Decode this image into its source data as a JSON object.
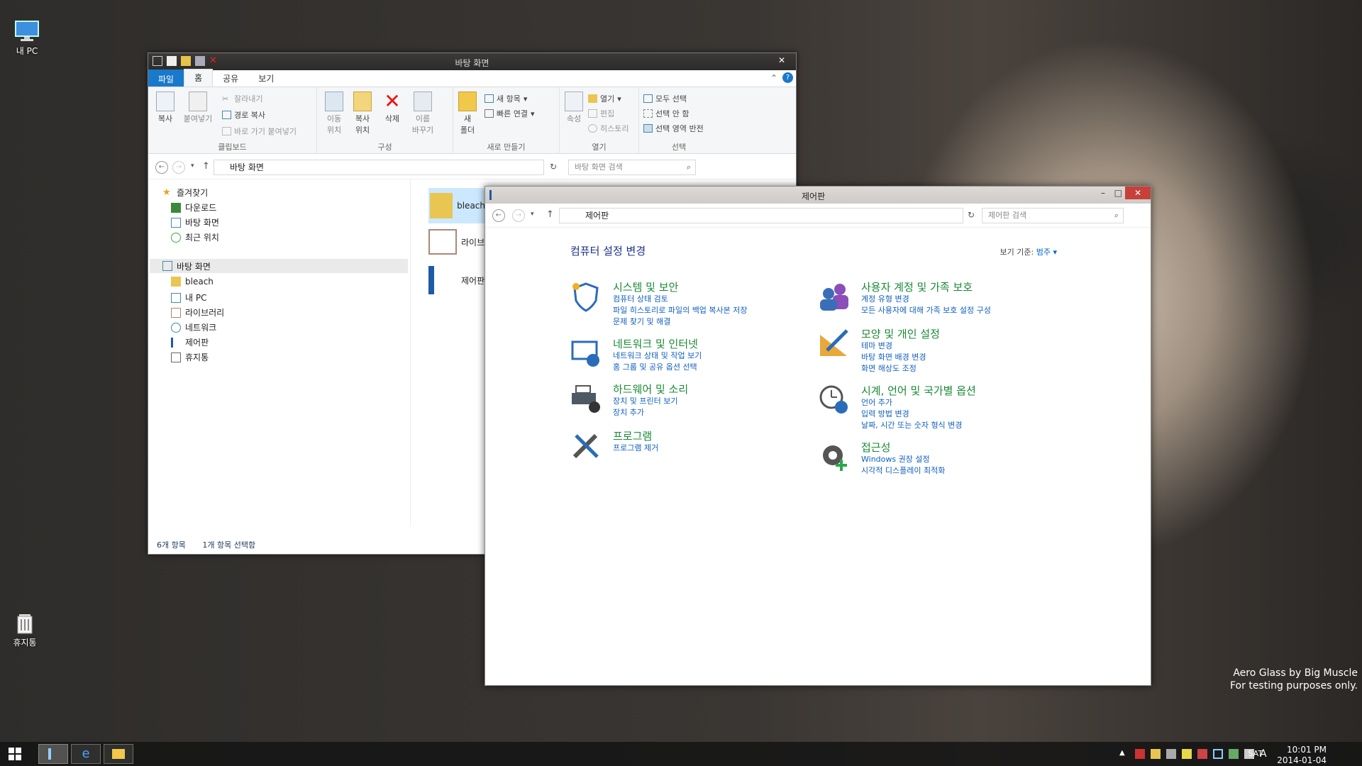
{
  "desktop": {
    "icons": [
      {
        "label": "내 PC",
        "icon": "monitor-icon"
      },
      {
        "label": "휴지통",
        "icon": "recycle-bin-icon"
      }
    ],
    "watermark": [
      "Aero Glass by Big Muscle",
      "For testing purposes only."
    ]
  },
  "explorer": {
    "title": "바탕 화면",
    "close": "✕",
    "tabs": [
      "파일",
      "홈",
      "공유",
      "보기"
    ],
    "ribbon": {
      "clipboard": {
        "copy": "복사",
        "paste": "붙여넣기",
        "cut": "잘라내기",
        "copy_path": "경로 복사",
        "paste_shortcut": "바로 가기 붙여넣기",
        "label": "클립보드"
      },
      "organize": {
        "move_to": "이동\n위치",
        "copy_to": "복사\n위치",
        "delete": "삭제",
        "rename": "이름\n바꾸기",
        "label": "구성"
      },
      "new": {
        "new_folder": "새\n폴더",
        "new_item": "새 항목",
        "easy_access": "빠른 연결",
        "label": "새로 만들기"
      },
      "open": {
        "properties": "속성",
        "open": "열기",
        "edit": "편집",
        "history": "히스토리",
        "label": "열기"
      },
      "select": {
        "select_all": "모두 선택",
        "select_none": "선택 안 함",
        "invert": "선택 영역 반전",
        "label": "선택"
      }
    },
    "address": "바탕 화면",
    "search_placeholder": "바탕 화면 검색",
    "tree": {
      "favorites": "즐겨찾기",
      "fav_items": [
        "다운로드",
        "바탕 화면",
        "최근 위치"
      ],
      "desktop": "바탕 화면",
      "desk_items": [
        "bleach",
        "내 PC",
        "라이브러리",
        "네트워크",
        "제어판",
        "휴지통"
      ]
    },
    "files": [
      "bleach",
      "라이브러리",
      "제어판"
    ],
    "status": {
      "count": "6개 항목",
      "selected": "1개 항목 선택함"
    }
  },
  "cpanel": {
    "title": "제어판",
    "address": "제어판",
    "search_placeholder": "제어판 검색",
    "heading": "컴퓨터 설정 변경",
    "view_by_label": "보기 기준:",
    "view_by_value": "범주 ▾",
    "categories": [
      {
        "title": "시스템 및 보안",
        "links": [
          "컴퓨터 상태 검토",
          "파일 히스토리로 파일의 백업 복사본 저장",
          "문제 찾기 및 해결"
        ]
      },
      {
        "title": "네트워크 및 인터넷",
        "links": [
          "네트워크 상태 및 작업 보기",
          "홈 그룹 및 공유 옵션 선택"
        ]
      },
      {
        "title": "하드웨어 및 소리",
        "links": [
          "장치 및 프린터 보기",
          "장치 추가"
        ]
      },
      {
        "title": "프로그램",
        "links": [
          "프로그램 제거"
        ]
      },
      {
        "title": "사용자 계정 및 가족 보호",
        "links": [
          "계정 유형 변경",
          "모든 사용자에 대해 가족 보호 설정 구성"
        ]
      },
      {
        "title": "모양 및 개인 설정",
        "links": [
          "테마 변경",
          "바탕 화면 배경 변경",
          "화면 해상도 조정"
        ]
      },
      {
        "title": "시계, 언어 및 국가별 옵션",
        "links": [
          "언어 추가",
          "입력 방법 변경",
          "날짜, 시간 또는 숫자 형식 변경"
        ]
      },
      {
        "title": "접근성",
        "links": [
          "Windows 권장 설정",
          "시각적 디스플레이 최적화"
        ]
      }
    ]
  },
  "taskbar": {
    "day": "SAT",
    "time": "10:01 PM",
    "date": "2014-01-04",
    "ime": "A"
  }
}
